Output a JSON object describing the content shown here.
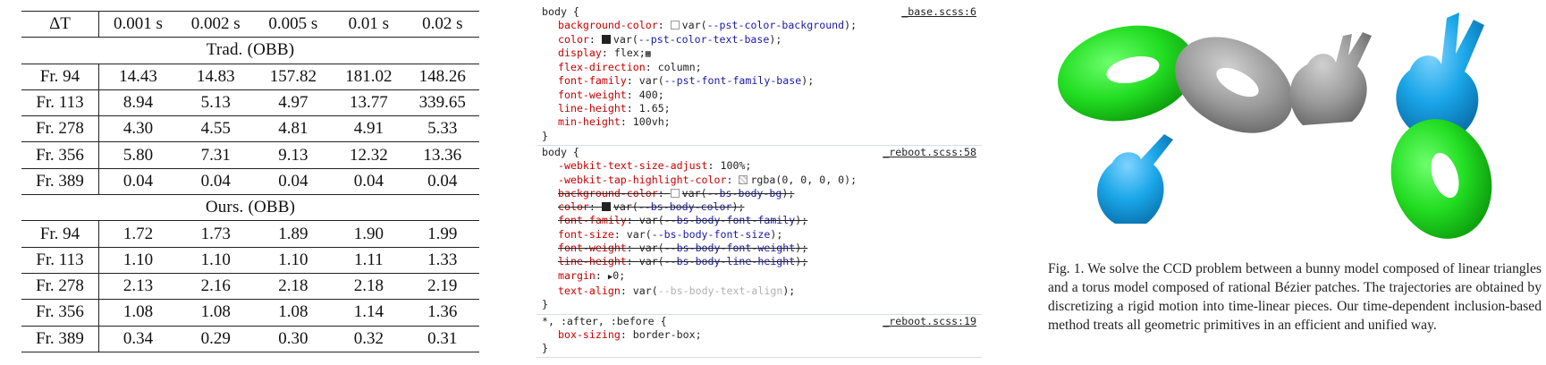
{
  "table": {
    "header": {
      "corner": "ΔT",
      "columns": [
        "0.001 s",
        "0.002 s",
        "0.005 s",
        "0.01 s",
        "0.02 s"
      ]
    },
    "sections": [
      {
        "title": "Trad. (OBB)",
        "rows": [
          {
            "label": "Fr. 94",
            "values": [
              "14.43",
              "14.83",
              "157.82",
              "181.02",
              "148.26"
            ]
          },
          {
            "label": "Fr. 113",
            "values": [
              "8.94",
              "5.13",
              "4.97",
              "13.77",
              "339.65"
            ]
          },
          {
            "label": "Fr. 278",
            "values": [
              "4.30",
              "4.55",
              "4.81",
              "4.91",
              "5.33"
            ]
          },
          {
            "label": "Fr. 356",
            "values": [
              "5.80",
              "7.31",
              "9.13",
              "12.32",
              "13.36"
            ]
          },
          {
            "label": "Fr. 389",
            "values": [
              "0.04",
              "0.04",
              "0.04",
              "0.04",
              "0.04"
            ]
          }
        ]
      },
      {
        "title": "Ours. (OBB)",
        "rows": [
          {
            "label": "Fr. 94",
            "values": [
              "1.72",
              "1.73",
              "1.89",
              "1.90",
              "1.99"
            ]
          },
          {
            "label": "Fr. 113",
            "values": [
              "1.10",
              "1.10",
              "1.10",
              "1.11",
              "1.33"
            ]
          },
          {
            "label": "Fr. 278",
            "values": [
              "2.13",
              "2.16",
              "2.18",
              "2.18",
              "2.19"
            ]
          },
          {
            "label": "Fr. 356",
            "values": [
              "1.08",
              "1.08",
              "1.08",
              "1.14",
              "1.36"
            ]
          },
          {
            "label": "Fr. 389",
            "values": [
              "0.34",
              "0.29",
              "0.30",
              "0.32",
              "0.31"
            ]
          }
        ]
      }
    ]
  },
  "css_panel": {
    "rules": [
      {
        "selector": "body {",
        "source": "_base.scss:6",
        "closing": "}",
        "declarations": [
          {
            "prop": "background-color",
            "swatch": "light",
            "value_pre": "var(",
            "var": "--pst-color-background",
            "value_post": ");",
            "struck": false
          },
          {
            "prop": "color",
            "swatch": "dark",
            "value_pre": "var(",
            "var": "--pst-color-text-base",
            "value_post": ");",
            "struck": false
          },
          {
            "prop": "display",
            "swatch": "",
            "value_pre": "flex;",
            "var": "",
            "value_post": "",
            "struck": false,
            "flex_icon": true
          },
          {
            "prop": "flex-direction",
            "swatch": "",
            "value_pre": "column;",
            "var": "",
            "value_post": "",
            "struck": false
          },
          {
            "prop": "font-family",
            "swatch": "",
            "value_pre": "var(",
            "var": "--pst-font-family-base",
            "value_post": ");",
            "struck": false
          },
          {
            "prop": "font-weight",
            "swatch": "",
            "value_pre": "400;",
            "var": "",
            "value_post": "",
            "struck": false
          },
          {
            "prop": "line-height",
            "swatch": "",
            "value_pre": "1.65;",
            "var": "",
            "value_post": "",
            "struck": false
          },
          {
            "prop": "min-height",
            "swatch": "",
            "value_pre": "100vh;",
            "var": "",
            "value_post": "",
            "struck": false
          }
        ]
      },
      {
        "selector": "body {",
        "source": "_reboot.scss:58",
        "closing": "}",
        "declarations": [
          {
            "prop": "-webkit-text-size-adjust",
            "swatch": "",
            "value_pre": "100%;",
            "var": "",
            "value_post": "",
            "struck": false
          },
          {
            "prop": "-webkit-tap-highlight-color",
            "swatch": "checker",
            "value_pre": "rgba(0, 0, 0, 0);",
            "var": "",
            "value_post": "",
            "struck": false
          },
          {
            "prop": "background-color",
            "swatch": "light",
            "value_pre": "var(",
            "var": "--bs-body-bg",
            "value_post": ");",
            "struck": true
          },
          {
            "prop": "color",
            "swatch": "dark",
            "value_pre": "var(",
            "var": "--bs-body-color",
            "value_post": ");",
            "struck": true
          },
          {
            "prop": "font-family",
            "swatch": "",
            "value_pre": "var(",
            "var": "--bs-body-font-family",
            "value_post": ");",
            "struck": true
          },
          {
            "prop": "font-size",
            "swatch": "",
            "value_pre": "var(",
            "var": "--bs-body-font-size",
            "value_post": ");",
            "struck": false
          },
          {
            "prop": "font-weight",
            "swatch": "",
            "value_pre": "var(",
            "var": "--bs-body-font-weight",
            "value_post": ");",
            "struck": true
          },
          {
            "prop": "line-height",
            "swatch": "",
            "value_pre": "var(",
            "var": "--bs-body-line-height",
            "value_post": ");",
            "struck": true
          },
          {
            "prop": "margin",
            "swatch": "",
            "value_pre": "0;",
            "var": "",
            "value_post": "",
            "struck": false,
            "expander": true
          },
          {
            "prop": "text-align",
            "swatch": "",
            "value_pre": "var(",
            "var": "--bs-body-text-align",
            "value_post": ");",
            "struck": false,
            "var_faint": true
          }
        ]
      },
      {
        "selector": "*, :after, :before {",
        "source": "_reboot.scss:19",
        "closing": "}",
        "declarations": [
          {
            "prop": "box-sizing",
            "swatch": "",
            "value_pre": "border-box;",
            "var": "",
            "value_post": "",
            "struck": false
          }
        ]
      }
    ]
  },
  "figure": {
    "colors": {
      "green": "#22dd22",
      "gray": "#9a9a9a",
      "blue": "#1aa6e8"
    },
    "caption": "Fig. 1.  We solve the CCD problem between a bunny model composed of linear triangles and a torus model composed of rational Bézier patches. The trajectories are obtained by discretizing a rigid motion into time-linear pieces. Our time-dependent inclusion-based method treats all geometric primitives in an efficient and unified way."
  }
}
